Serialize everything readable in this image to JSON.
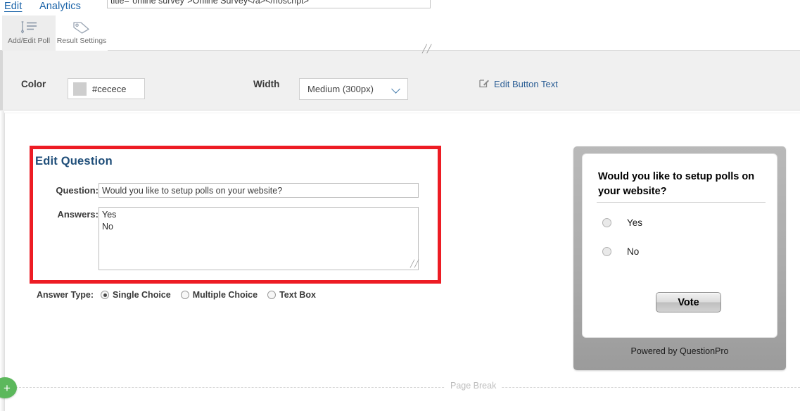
{
  "top_tabs": [
    {
      "label": "Edit",
      "active": true
    },
    {
      "label": "Analytics",
      "active": false
    }
  ],
  "ribbon": {
    "buttons": [
      {
        "label": "Add/Edit Poll",
        "icon": "pen-list-icon",
        "active": true
      },
      {
        "label": "Result Settings",
        "icon": "tag-icon",
        "active": false
      }
    ]
  },
  "embed": {
    "code_value": "title=\"online survey\">Online Survey</a></noscript>",
    "resize_grip": "╱╱"
  },
  "settings": {
    "color_label": "Color",
    "color_value": "#cecece",
    "color_swatch_hex": "#cecece",
    "width_label": "Width",
    "width_value": "Medium (300px)",
    "width_chevron": "chevron-down-icon",
    "edit_button_text_link": "Edit Button Text",
    "edit_button_text_icon": "pencil-square-icon",
    "link_color": "#2a5d94"
  },
  "edit_question": {
    "title": "Edit Question",
    "question_label": "Question:",
    "question_value": "Would you like to setup polls on your website?",
    "answers_label": "Answers:",
    "answers_value": "Yes\nNo",
    "textarea_grip": "╱╱",
    "answer_type_label": "Answer Type:",
    "answer_types": [
      {
        "label": "Single Choice",
        "selected": true
      },
      {
        "label": "Multiple Choice",
        "selected": false
      },
      {
        "label": "Text Box",
        "selected": false
      }
    ],
    "highlight_color": "#ed1c24"
  },
  "preview": {
    "question": "Would you like to setup polls on your website?",
    "options": [
      {
        "label": "Yes",
        "selected": false
      },
      {
        "label": "No",
        "selected": false
      }
    ],
    "vote_button": "Vote",
    "footer": "Powered by QuestionPro"
  },
  "page_break": {
    "label": "Page Break",
    "add_button_glyph": "+",
    "add_button_color": "#5cb85c"
  }
}
